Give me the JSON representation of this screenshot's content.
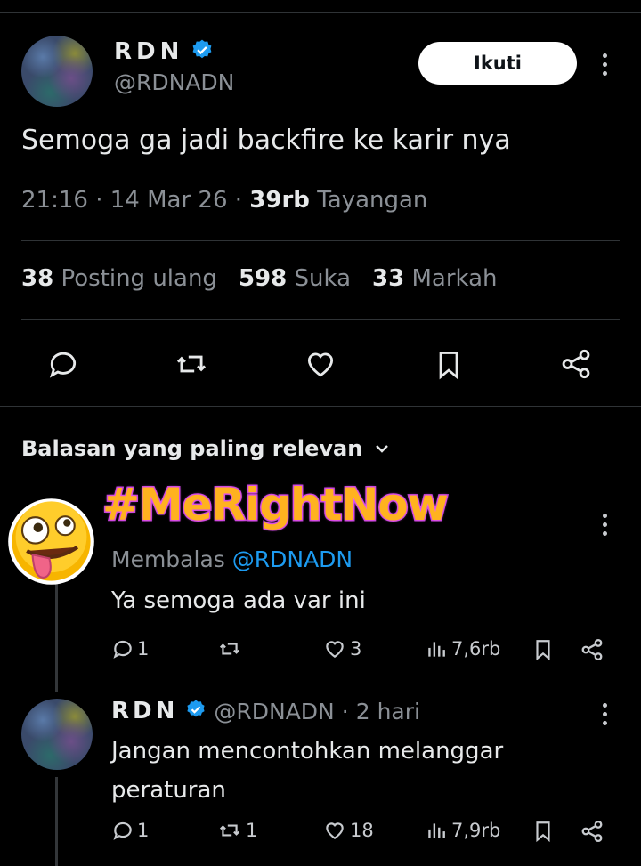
{
  "post": {
    "author_name": "RDN",
    "author_handle": "@RDNADN",
    "follow_label": "Ikuti",
    "text": "Semoga ga jadi backfire ke karir nya",
    "time": "21:16",
    "date": "14 Mar 26",
    "views_count": "39rb",
    "views_label": "Tayangan",
    "reposts_count": "38",
    "reposts_label": "Posting ulang",
    "likes_count": "598",
    "likes_label": "Suka",
    "bookmarks_count": "33",
    "bookmarks_label": "Markah"
  },
  "replies_header": "Balasan yang paling relevan",
  "sticker_text": "#MeRightNow",
  "reply1": {
    "replying_prefix": "Membalas",
    "replying_to": "@RDNADN",
    "text": "Ya semoga ada var ini",
    "reply_count": "1",
    "repost_count": "",
    "like_count": "3",
    "views": "7,6rb"
  },
  "reply2": {
    "author_name": "RDN",
    "author_handle": "@RDNADN",
    "age": "2 hari",
    "text_line1": "Jangan mencontohkan melanggar",
    "text_line2": "peraturan",
    "reply_count": "1",
    "repost_count": "1",
    "like_count": "18",
    "views": "7,9rb"
  },
  "colors": {
    "background": "#000000",
    "text": "#e7e9ea",
    "muted": "#8b9096",
    "link": "#1d9bf0",
    "verified": "#1d9bf0",
    "divider": "#2f3336"
  },
  "icons": [
    "verified-badge-icon",
    "more-options-icon",
    "reply-icon",
    "repost-icon",
    "like-icon",
    "bookmark-icon",
    "share-icon",
    "chevron-down-icon",
    "views-icon",
    "emoji-sticker-icon"
  ]
}
